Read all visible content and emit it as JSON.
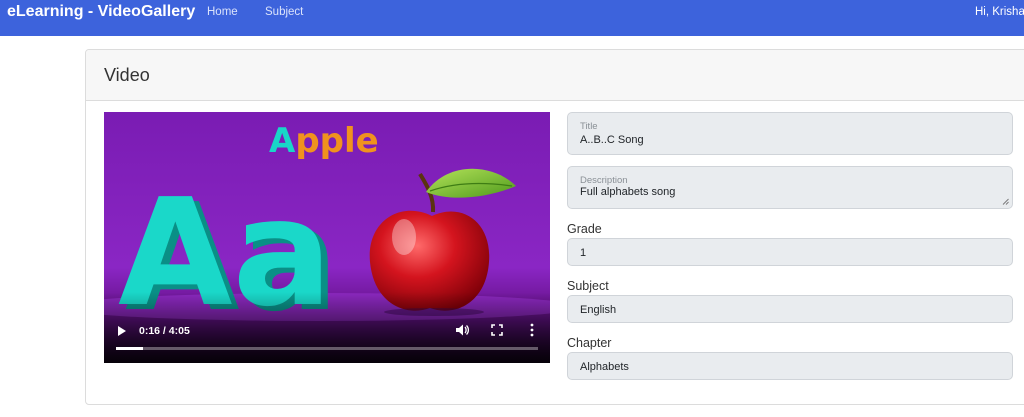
{
  "navbar": {
    "brand": "eLearning - VideoGallery",
    "links": [
      "Home",
      "Subject"
    ],
    "greeting": "Hi, Krisha"
  },
  "card": {
    "title": "Video"
  },
  "video": {
    "thumbnail_word_first": "A",
    "thumbnail_word_rest": "pple",
    "thumbnail_letters": "Aa",
    "time": "0:16 / 4:05",
    "progress": 0.065
  },
  "form": {
    "title": {
      "label": "Title",
      "value": "A..B..C Song"
    },
    "description": {
      "label": "Description",
      "value": "Full alphabets song"
    },
    "grade": {
      "label": "Grade",
      "value": "1"
    },
    "subject": {
      "label": "Subject",
      "value": "English"
    },
    "chapter": {
      "label": "Chapter",
      "value": "Alphabets"
    }
  },
  "colors": {
    "navbar": "#3d63dc",
    "video_bg": "#7d1fb0",
    "letter_teal": "#19d6c8",
    "letter_orange": "#f0921e",
    "apple_red": "#c01620"
  }
}
